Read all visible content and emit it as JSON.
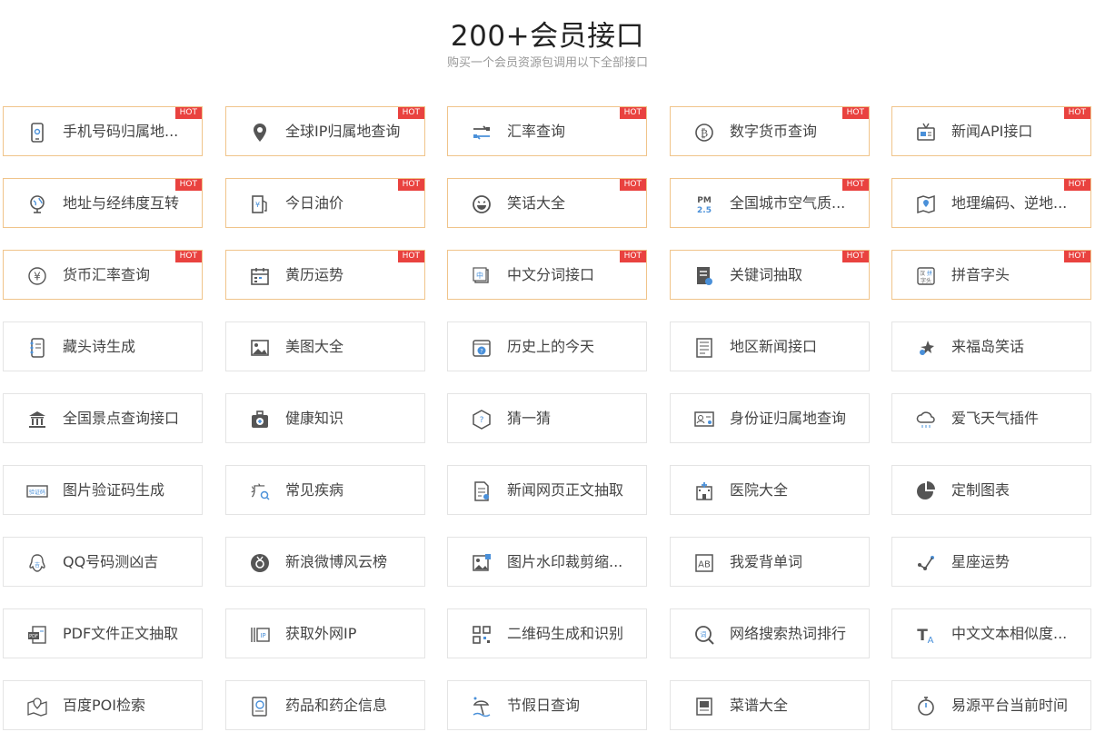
{
  "header": {
    "title": "200+会员接口",
    "subtitle": "购买一个会员资源包调用以下全部接口"
  },
  "hot_label": "HOT",
  "apis": [
    {
      "label": "手机号码归属地...",
      "icon": "mobile-phone-icon",
      "hot": true
    },
    {
      "label": "全球IP归属地查询",
      "icon": "location-pin-icon",
      "hot": true
    },
    {
      "label": "汇率查询",
      "icon": "exchange-arrows-icon",
      "hot": true
    },
    {
      "label": "数字货币查询",
      "icon": "bitcoin-icon",
      "hot": true
    },
    {
      "label": "新闻API接口",
      "icon": "tv-news-icon",
      "hot": true
    },
    {
      "label": "地址与经纬度互转",
      "icon": "globe-icon",
      "hot": true
    },
    {
      "label": "今日油价",
      "icon": "fuel-pump-icon",
      "hot": true
    },
    {
      "label": "笑话大全",
      "icon": "laughing-face-icon",
      "hot": true
    },
    {
      "label": "全国城市空气质...",
      "icon": "pm25-icon",
      "hot": true
    },
    {
      "label": "地理编码、逆地...",
      "icon": "map-icon",
      "hot": true
    },
    {
      "label": "货币汇率查询",
      "icon": "yen-coin-icon",
      "hot": true
    },
    {
      "label": "黄历运势",
      "icon": "calendar-icon",
      "hot": true
    },
    {
      "label": "中文分词接口",
      "icon": "chinese-char-icon",
      "hot": true
    },
    {
      "label": "关键词抽取",
      "icon": "document-search-icon",
      "hot": true
    },
    {
      "label": "拼音字头",
      "icon": "pinyin-icon",
      "hot": true
    },
    {
      "label": "藏头诗生成",
      "icon": "notebook-icon",
      "hot": false
    },
    {
      "label": "美图大全",
      "icon": "picture-icon",
      "hot": false
    },
    {
      "label": "历史上的今天",
      "icon": "calendar-history-icon",
      "hot": false
    },
    {
      "label": "地区新闻接口",
      "icon": "newspaper-icon",
      "hot": false
    },
    {
      "label": "来福岛笑话",
      "icon": "star-burst-icon",
      "hot": false
    },
    {
      "label": "全国景点查询接口",
      "icon": "temple-icon",
      "hot": false
    },
    {
      "label": "健康知识",
      "icon": "medical-kit-icon",
      "hot": false
    },
    {
      "label": "猜一猜",
      "icon": "cube-question-icon",
      "hot": false
    },
    {
      "label": "身份证归属地查询",
      "icon": "id-card-icon",
      "hot": false
    },
    {
      "label": "爱飞天气插件",
      "icon": "cloud-rain-icon",
      "hot": false
    },
    {
      "label": "图片验证码生成",
      "icon": "captcha-icon",
      "hot": false
    },
    {
      "label": "常见疾病",
      "icon": "disease-search-icon",
      "hot": false
    },
    {
      "label": "新闻网页正文抽取",
      "icon": "web-document-icon",
      "hot": false
    },
    {
      "label": "医院大全",
      "icon": "hospital-icon",
      "hot": false
    },
    {
      "label": "定制图表",
      "icon": "pie-chart-icon",
      "hot": false
    },
    {
      "label": "QQ号码测凶吉",
      "icon": "qq-penguin-icon",
      "hot": false
    },
    {
      "label": "新浪微博风云榜",
      "icon": "medal-icon",
      "hot": false
    },
    {
      "label": "图片水印裁剪缩...",
      "icon": "image-edit-icon",
      "hot": false
    },
    {
      "label": "我爱背单词",
      "icon": "ab-book-icon",
      "hot": false
    },
    {
      "label": "星座运势",
      "icon": "constellation-icon",
      "hot": false
    },
    {
      "label": "PDF文件正文抽取",
      "icon": "pdf-icon",
      "hot": false
    },
    {
      "label": "获取外网IP",
      "icon": "ip-address-icon",
      "hot": false
    },
    {
      "label": "二维码生成和识别",
      "icon": "qr-code-icon",
      "hot": false
    },
    {
      "label": "网络搜索热词排行",
      "icon": "search-word-icon",
      "hot": false
    },
    {
      "label": "中文文本相似度...",
      "icon": "text-type-icon",
      "hot": false
    },
    {
      "label": "百度POI检索",
      "icon": "map-pin-icon",
      "hot": false
    },
    {
      "label": "药品和药企信息",
      "icon": "medicine-doc-icon",
      "hot": false
    },
    {
      "label": "节假日查询",
      "icon": "beach-icon",
      "hot": false
    },
    {
      "label": "菜谱大全",
      "icon": "recipe-book-icon",
      "hot": false
    },
    {
      "label": "易源平台当前时间",
      "icon": "stopwatch-icon",
      "hot": false
    }
  ]
}
